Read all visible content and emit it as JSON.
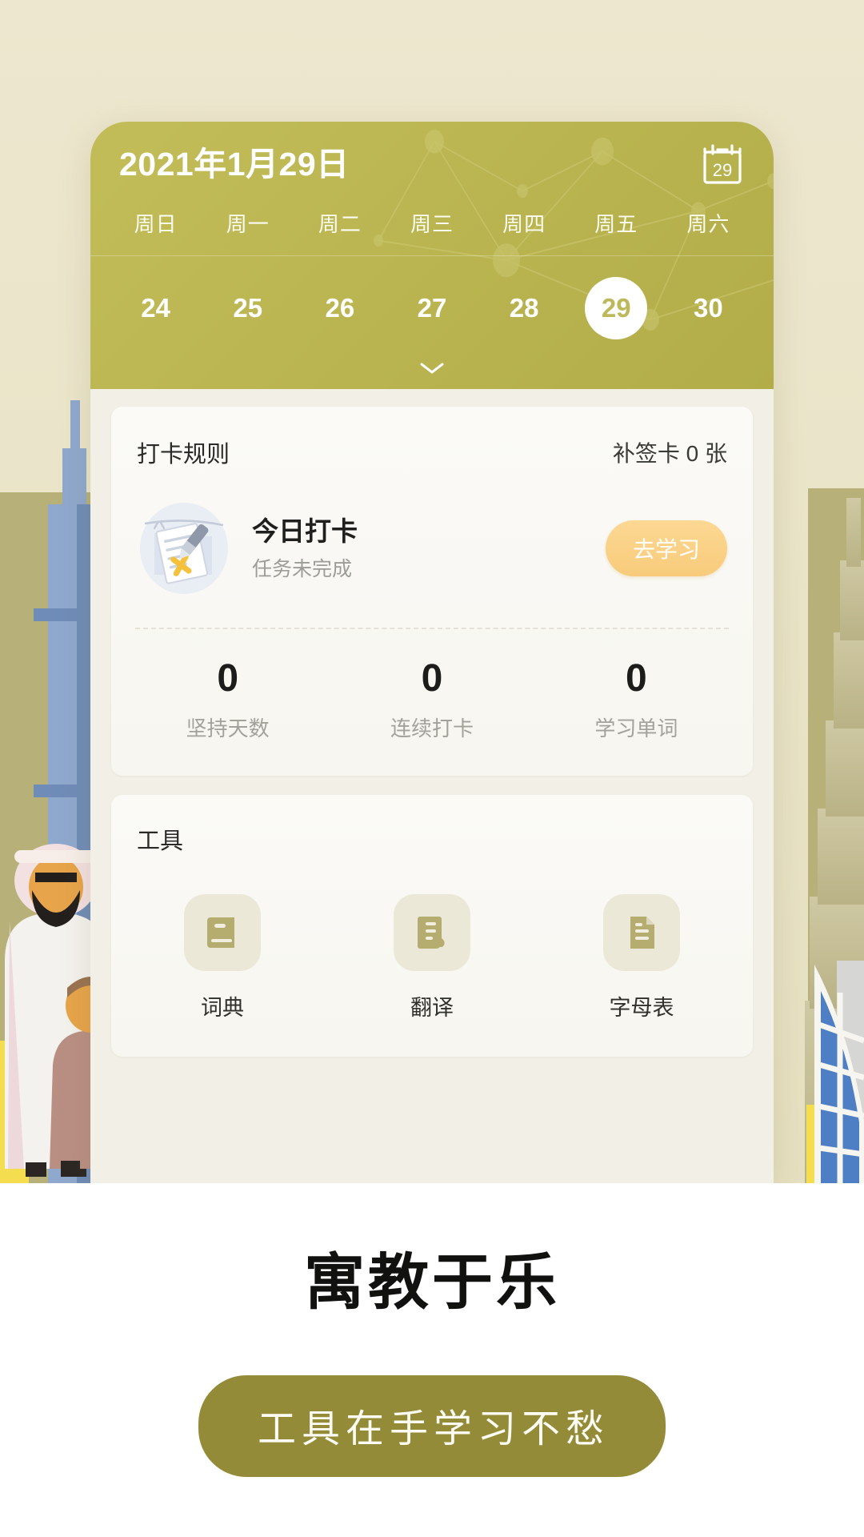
{
  "theme": {
    "page_background": "#ffffff",
    "hero_background": "#ece6cd",
    "header_green": "#bdb854",
    "accent_yellow": "#f9cd7f",
    "cta_olive": "#938b38",
    "card_background": "#f9f8f3"
  },
  "calendar": {
    "title": "2021年1月29日",
    "icon_name": "calendar-icon",
    "icon_day": "29",
    "weekdays": [
      "周日",
      "周一",
      "周二",
      "周三",
      "周四",
      "周五",
      "周六"
    ],
    "days": [
      {
        "label": "24",
        "selected": false
      },
      {
        "label": "25",
        "selected": false
      },
      {
        "label": "26",
        "selected": false
      },
      {
        "label": "27",
        "selected": false
      },
      {
        "label": "28",
        "selected": false
      },
      {
        "label": "29",
        "selected": true
      },
      {
        "label": "30",
        "selected": false
      }
    ],
    "expand_icon": "chevron-down-icon"
  },
  "checkin_card": {
    "rules_label": "打卡规则",
    "makeup_cards_label": "补签卡 0 张",
    "today": {
      "illustration_name": "checklist-illustration",
      "title": "今日打卡",
      "subtitle": "任务未完成",
      "action_label": "去学习"
    },
    "stats": [
      {
        "value": "0",
        "label": "坚持天数"
      },
      {
        "value": "0",
        "label": "连续打卡"
      },
      {
        "value": "0",
        "label": "学习单词"
      }
    ]
  },
  "tools_card": {
    "title": "工具",
    "items": [
      {
        "label": "词典",
        "icon": "book-icon"
      },
      {
        "label": "翻译",
        "icon": "translate-document-icon"
      },
      {
        "label": "字母表",
        "icon": "file-text-icon"
      }
    ]
  },
  "promo": {
    "tagline": "寓教于乐",
    "cta_label": "工具在手学习不愁"
  }
}
